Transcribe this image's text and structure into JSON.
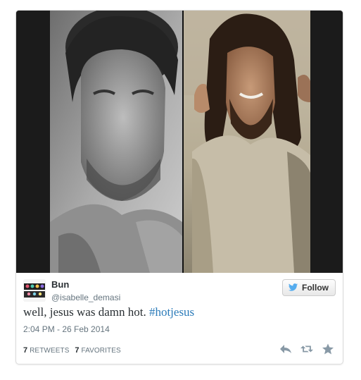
{
  "tweet": {
    "display_name": "Bun",
    "handle": "@isabelle_demasi",
    "text": "well, jesus was damn hot.",
    "hashtag": "#hotjesus",
    "timestamp": "2:04 PM - 26 Feb 2014",
    "follow_label": "Follow",
    "retweets_count": "7",
    "retweets_label": "RETWEETS",
    "favorites_count": "7",
    "favorites_label": "FAVORITES"
  },
  "icons": {
    "follow": "twitter-bird-icon",
    "reply": "reply-icon",
    "retweet": "retweet-icon",
    "favorite": "star-icon"
  },
  "colors": {
    "hashtag": "#2b7bb9",
    "twitter_blue": "#55acee",
    "muted": "#66757f",
    "text": "#292f33"
  },
  "media": {
    "kind": "photo collage",
    "panels": 2
  }
}
